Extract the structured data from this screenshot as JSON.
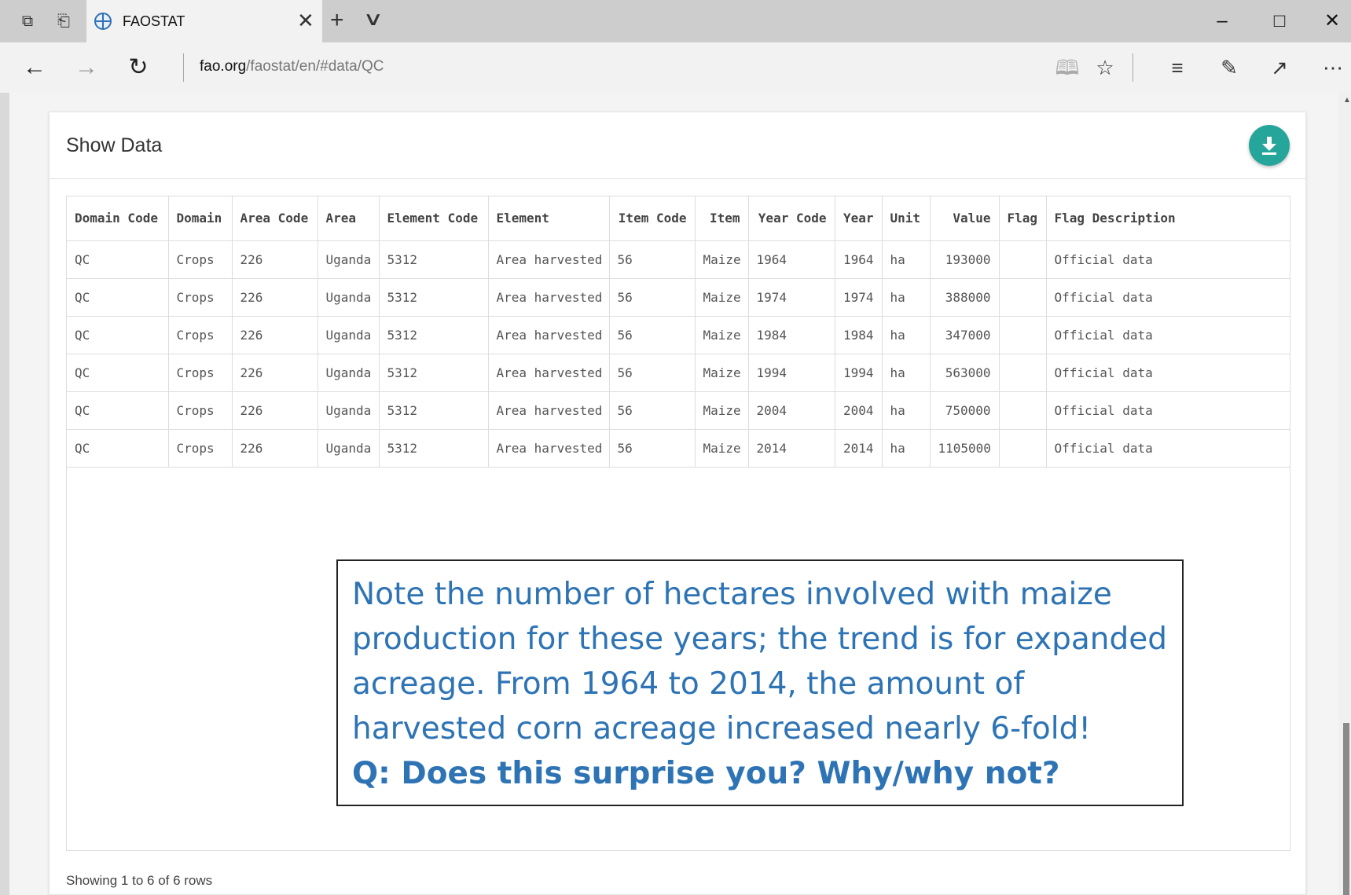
{
  "browser": {
    "tab_title": "FAOSTAT",
    "address_host": "fao.org",
    "address_path": "/faostat/en/#data/QC",
    "icons": [
      "tab-set-aside-icon",
      "tab-preview-icon",
      "globe-icon",
      "close-icon",
      "plus-icon",
      "chevron-down-icon",
      "minimize-icon",
      "maximize-icon",
      "window-close-icon",
      "back-arrow-icon",
      "forward-arrow-icon",
      "refresh-icon",
      "reading-view-icon",
      "favorite-star-icon",
      "hub-icon",
      "web-note-icon",
      "share-icon",
      "more-icon"
    ]
  },
  "panel": {
    "title": "Show Data",
    "download_color": "#26a69a"
  },
  "table": {
    "headers": [
      "Domain Code",
      "Domain",
      "Area Code",
      "Area",
      "Element Code",
      "Element",
      "Item Code",
      "Item",
      "Year Code",
      "Year",
      "Unit",
      "Value",
      "Flag",
      "Flag Description"
    ],
    "rows": [
      [
        "QC",
        "Crops",
        "226",
        "Uganda",
        "5312",
        "Area harvested",
        "56",
        "Maize",
        "1964",
        "1964",
        "ha",
        "193000",
        "",
        "Official data"
      ],
      [
        "QC",
        "Crops",
        "226",
        "Uganda",
        "5312",
        "Area harvested",
        "56",
        "Maize",
        "1974",
        "1974",
        "ha",
        "388000",
        "",
        "Official data"
      ],
      [
        "QC",
        "Crops",
        "226",
        "Uganda",
        "5312",
        "Area harvested",
        "56",
        "Maize",
        "1984",
        "1984",
        "ha",
        "347000",
        "",
        "Official data"
      ],
      [
        "QC",
        "Crops",
        "226",
        "Uganda",
        "5312",
        "Area harvested",
        "56",
        "Maize",
        "1994",
        "1994",
        "ha",
        "563000",
        "",
        "Official data"
      ],
      [
        "QC",
        "Crops",
        "226",
        "Uganda",
        "5312",
        "Area harvested",
        "56",
        "Maize",
        "2004",
        "2004",
        "ha",
        "750000",
        "",
        "Official data"
      ],
      [
        "QC",
        "Crops",
        "226",
        "Uganda",
        "5312",
        "Area harvested",
        "56",
        "Maize",
        "2014",
        "2014",
        "ha",
        "1105000",
        "",
        "Official data"
      ]
    ]
  },
  "footer": {
    "showing": "Showing 1 to 6 of 6 rows"
  },
  "note": {
    "lines": [
      "Note the number of hectares involved with maize",
      "production for these years; the trend is for expanded",
      "acreage.  From 1964 to 2014, the amount of",
      "harvested corn acreage increased nearly 6-fold!"
    ],
    "question": "Q:  Does this surprise you?  Why/why not?",
    "color": "#2e74b5"
  }
}
